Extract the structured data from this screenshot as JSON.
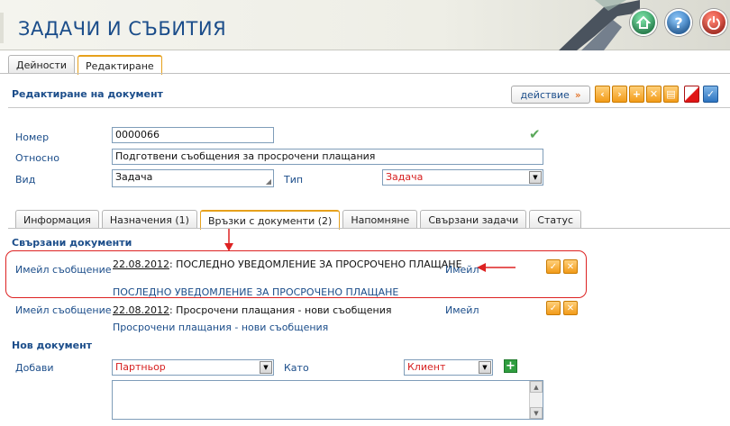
{
  "app": {
    "title": "ЗАДАЧИ И СЪБИТИЯ"
  },
  "header_buttons": [
    {
      "icon": "home-icon"
    },
    {
      "icon": "help-icon",
      "label": "?"
    },
    {
      "icon": "power-icon"
    }
  ],
  "top_tabs": [
    {
      "label": "Дейности",
      "active": false
    },
    {
      "label": "Редактиране",
      "active": true
    }
  ],
  "toolbar": {
    "heading": "Редактиране на документ",
    "action_label": "действие",
    "action_arrow": "»",
    "buttons": [
      "chevron-left-icon",
      "chevron-right-icon",
      "plus-icon",
      "close-icon",
      "print-icon",
      "clear-icon",
      "save-icon"
    ]
  },
  "form": {
    "number_label": "Номер",
    "number_value": "0000066",
    "subject_label": "Относно",
    "subject_value": "Подготвени съобщения за просрочени плащания",
    "kind_label": "Вид",
    "kind_value": "Задача",
    "type_label": "Тип",
    "type_value": "Задача"
  },
  "inner_tabs": [
    {
      "label": "Информация",
      "active": false
    },
    {
      "label": "Назначения (1)",
      "active": false
    },
    {
      "label": "Връзки с документи (2)",
      "active": true
    },
    {
      "label": "Напомняне",
      "active": false
    },
    {
      "label": "Свързани задачи",
      "active": false
    },
    {
      "label": "Статус",
      "active": false
    }
  ],
  "related_docs": {
    "heading": "Свързани документи",
    "items": [
      {
        "kind": "Имейл съобщение",
        "date": "22.08.2012",
        "title": ": ПОСЛЕДНО УВЕДОМЛЕНИЕ ЗА ПРОСРОЧЕНО ПЛАЩАНЕ",
        "channel": "Имейл",
        "subtitle": "ПОСЛЕДНО УВЕДОМЛЕНИЕ ЗА ПРОСРОЧЕНО ПЛАЩАНЕ"
      },
      {
        "kind": "Имейл съобщение",
        "date": "22.08.2012",
        "title": ": Просрочени плащания - нови съобщения",
        "channel": "Имейл",
        "subtitle": "Просрочени плащания - нови съобщения"
      }
    ]
  },
  "new_doc": {
    "heading": "Нов документ",
    "add_label": "Добави",
    "add_value": "Партньор",
    "as_label": "Като",
    "as_value": "Клиент"
  },
  "colors": {
    "accent": "#1b4d8a",
    "highlight": "#d22222",
    "button_orange": "#f29b19"
  }
}
